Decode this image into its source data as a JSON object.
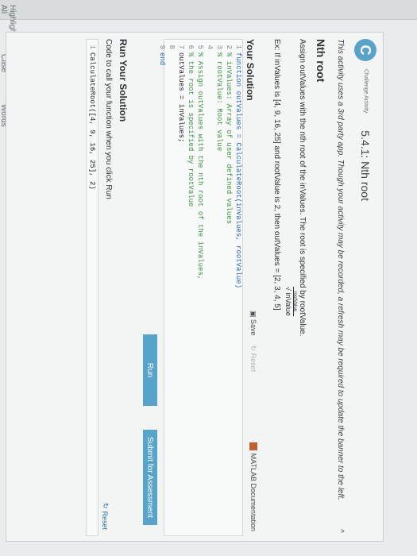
{
  "left_links": [
    "Highlight All",
    "Match Case",
    "Whole Words"
  ],
  "header": {
    "badge_letter": "C",
    "badge_text": "Challenge Activity",
    "title": "5.4.1: Nth root"
  },
  "banner": "This activity uses a 3rd party app. Though your activity may be recorded, a refresh may be required to update the banner to the left.",
  "caret": "^",
  "problem": {
    "title": "Nth root",
    "description": "Assign outValues with the nth root of the inValues. The root is specified by rootValue.",
    "formula_root": "rootValue",
    "formula_value": "√ inValue",
    "example": "Ex: If inValues is [4, 9, 16, 25] and rootValue is 2, then outValues = [2, 3, 4, 5]"
  },
  "solution": {
    "heading": "Your Solution",
    "save": "Save",
    "reset": "Reset",
    "docs": "MATLAB Documentation",
    "code_lines": [
      {
        "n": "1",
        "t": "function outValues = CalculateRoot(inValues, rootValue)"
      },
      {
        "n": "2",
        "t": "% inValues: Array of user defined values"
      },
      {
        "n": "3",
        "t": "% rootValue: Root value"
      },
      {
        "n": "4",
        "t": ""
      },
      {
        "n": "5",
        "t": "% Assign outValues with the nth root of the inValues,"
      },
      {
        "n": "6",
        "t": "% the root is specified by rootValue"
      },
      {
        "n": "7",
        "t": "outValues = inValues;"
      },
      {
        "n": "8",
        "t": ""
      },
      {
        "n": "9",
        "t": "end"
      }
    ]
  },
  "actions": {
    "run": "Run",
    "submit": "Submit for Assessment"
  },
  "run_solution": {
    "heading": "Run Your Solution",
    "subtitle": "Code to call your function when you click Run",
    "reset": "Reset",
    "call_line_n": "1",
    "call_line": "CalculateRoot([4, 9, 16, 25], 2)"
  }
}
